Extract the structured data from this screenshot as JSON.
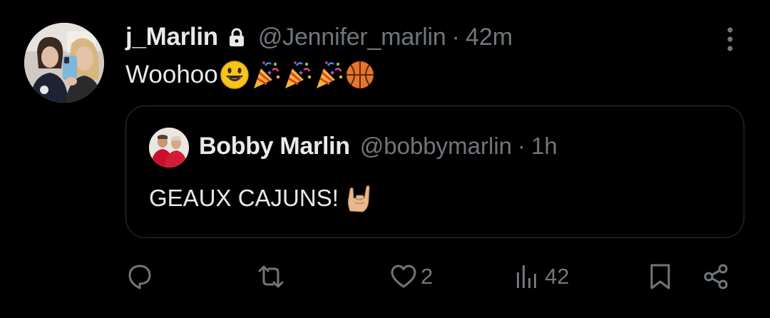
{
  "tweet": {
    "display_name": "j_Marlin",
    "handle": "@Jennifer_marlin",
    "separator": "·",
    "time": "42m",
    "text": "Woohoo",
    "emojis": [
      "smiling-face-emoji",
      "party-popper-emoji",
      "party-popper-emoji",
      "party-popper-emoji",
      "basketball-emoji"
    ]
  },
  "quote": {
    "display_name": "Bobby Marlin",
    "handle": "@bobbymarlin",
    "separator": "·",
    "time": "1h",
    "text": "GEAUX CAJUNS!",
    "emoji": "sign-of-the-horns-emoji"
  },
  "actions": {
    "reply_count": "",
    "retweet_count": "",
    "like_count": "2",
    "views_count": "42"
  },
  "colors": {
    "background": "#000000",
    "text_primary": "#e7e9ea",
    "text_secondary": "#71767b",
    "border": "#2f3336"
  }
}
